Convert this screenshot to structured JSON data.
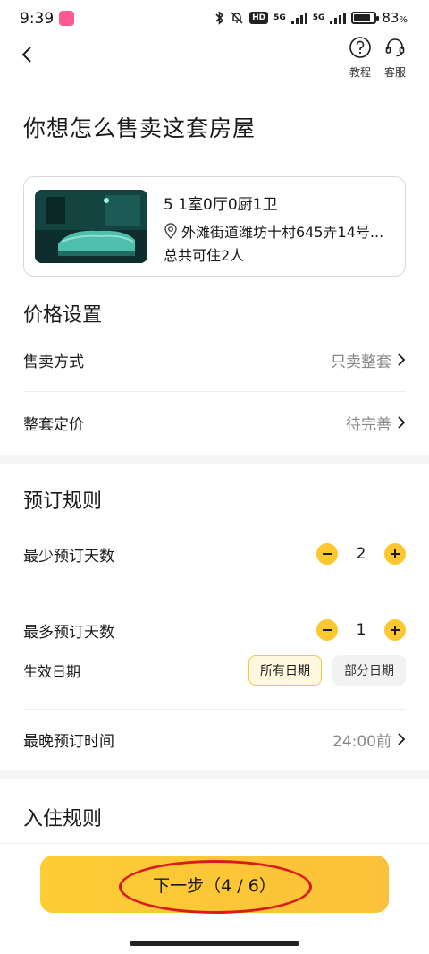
{
  "status_bar": {
    "time": "9:39",
    "net1": "5G",
    "net2": "5G",
    "hd": "HD",
    "battery_percent": "83",
    "battery_suffix": "%",
    "battery_level": 0.83
  },
  "header": {
    "tutorial_label": "教程",
    "service_label": "客服"
  },
  "page_title": "你想怎么售卖这套房屋",
  "house": {
    "title": "5  1室0厅0厨1卫",
    "address": "外滩街道潍坊十村645弄14号...",
    "guests": "总共可住2人"
  },
  "price_section": {
    "title": "价格设置",
    "sale_mode_label": "售卖方式",
    "sale_mode_value": "只卖整套",
    "whole_price_label": "整套定价",
    "whole_price_value": "待完善"
  },
  "booking_section": {
    "title": "预订规则",
    "min_days_label": "最少预订天数",
    "min_days_value": "2",
    "max_days_label": "最多预订天数",
    "max_days_value": "1",
    "effective_date_label": "生效日期",
    "date_option_all": "所有日期",
    "date_option_partial": "部分日期",
    "latest_time_label": "最晚预订时间",
    "latest_time_value": "24:00前"
  },
  "checkin_section": {
    "title": "入住规则"
  },
  "next_button": "下一步（4 / 6）",
  "colors": {
    "accent": "#fdc82f",
    "annotation_ring": "#d81b1b"
  }
}
